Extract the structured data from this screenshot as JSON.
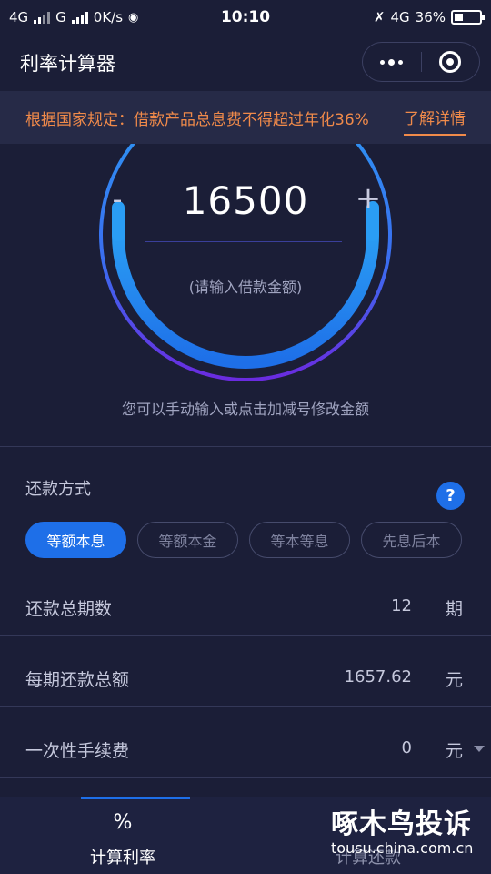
{
  "status": {
    "net1": "4G",
    "net2": "G",
    "speed": "0K/s",
    "time": "10:10",
    "net3": "4G",
    "battery": "36%"
  },
  "navbar": {
    "title": "利率计算器",
    "more_icon": "more-dots-icon",
    "close_icon": "target-circle-icon"
  },
  "notice": {
    "text": "根据国家规定：借款产品总息费不得超过年化36%",
    "link": "了解详情",
    "color": "#f08a4a"
  },
  "loan": {
    "amount": "16500",
    "minus": "-",
    "plus": "+",
    "hint": "(请输入借款金额)",
    "tip": "您可以手动输入或点击加减号修改金额"
  },
  "repay": {
    "label": "还款方式",
    "help": "?",
    "methods": [
      "等额本息",
      "等额本金",
      "等本等息",
      "先息后本"
    ],
    "selected": "等额本息"
  },
  "rows": [
    {
      "label": "还款总期数",
      "value": "12",
      "unit": "期"
    },
    {
      "label": "每期还款总额",
      "value": "1657.62",
      "unit": "元"
    },
    {
      "label": "一次性手续费",
      "value": "0",
      "unit": "元"
    }
  ],
  "tabs": [
    {
      "icon": "%",
      "label": "计算利率"
    },
    {
      "icon": "",
      "label": "计算还款"
    }
  ],
  "watermark": {
    "title": "啄木鸟投诉",
    "url": "tousu.china.com.cn"
  },
  "colors": {
    "background": "#1b1e37",
    "accent": "#1e6fe8",
    "gauge_start": "#2a9df4",
    "gauge_end": "#6a2be0"
  }
}
